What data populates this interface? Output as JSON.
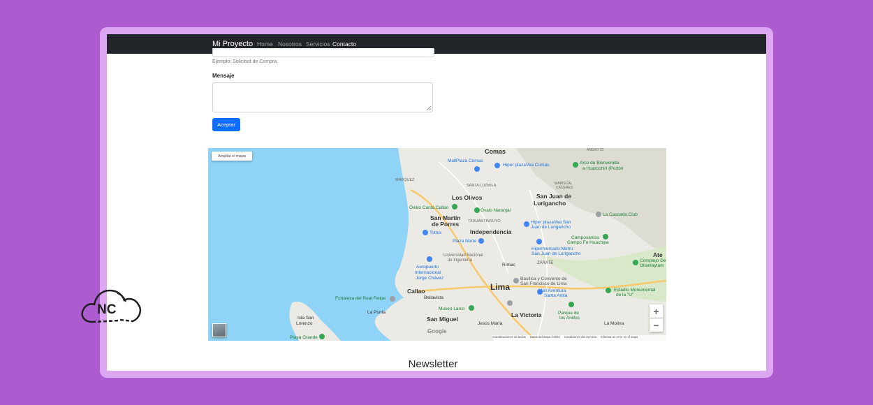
{
  "nav": {
    "brand": "Mi Proyecto",
    "links": [
      "Home",
      "Nosotros",
      "Servicios",
      "Contacto"
    ],
    "active": "Contacto"
  },
  "form": {
    "subject_help": "Ejemplo: Solicitud de Compra",
    "message_label": "Mensaje",
    "message_value": "",
    "submit_label": "Aceptar"
  },
  "map": {
    "enlarge_label": "Ampliar el mapa",
    "zoom_in": "+",
    "zoom_out": "−",
    "logo_text": "Google",
    "footer_links": [
      "Combinaciones de teclas",
      "Datos del mapa ©2022",
      "Condiciones del Servicio",
      "Informar un error en el mapa"
    ],
    "places": {
      "comas": "Comas",
      "los_olivos": "Los Olivos",
      "san_martin": "San Martín",
      "de_porres": "de Porres",
      "independencia": "Independencia",
      "lima": "Lima",
      "callao": "Callao",
      "bellavista": "Bellavista",
      "la_punta": "La Punta",
      "san_miguel": "San Miguel",
      "la_victoria": "La Victoria",
      "rimac": "Rímac",
      "zarate": "ZÁRATE",
      "sjl1": "San Juan de",
      "sjl2": "Lurigancho",
      "ate": "Ate",
      "la_molina": "La Molina",
      "isla1": "Isla San",
      "isla2": "Lorenzo",
      "playa": "Playa Grande",
      "marquez": "MARQUEZ",
      "santa_luzmila": "SANTA LUZMILA",
      "tahuantinsuyo": "TAHUANTINSUYO",
      "mariscal": "MARISCAL",
      "caceres": "CACERES",
      "jesus_maria": "Jesús María",
      "ciudad_dios": "ANEXO 22",
      "poi_mallplaza": "MallPlaza Comas",
      "poi_hiper_comas": "Hiper plazaVea Comas",
      "poi_arco1": "Arco de Bienvenida",
      "poi_arco2": "a Huarochirí (Portón",
      "poi_ovalo_callao": "Óvalo Canta Callao",
      "poi_ovalo_naranjal": "Óvalo Naranjal",
      "poi_tottus": "Tottus",
      "poi_plaza_norte": "Plaza Norte",
      "poi_uni1": "Universidad Nacional",
      "poi_uni2": "de Ingeniería",
      "poi_aero1": "Aeropuerto",
      "poi_aero2": "Internacional",
      "poi_aero3": "Jorge Chávez",
      "poi_fortaleza": "Fortaleza del Real Felipe",
      "poi_museo": "Museo Larco",
      "poi_basilica1": "Basílica y Convento de",
      "poi_basilica2": "San Francisco de Lima",
      "poi_mall_aventura1": "Mall Aventura",
      "poi_mall_aventura2": "Santa Anita",
      "poi_parque1": "Parque de",
      "poi_parque2": "los Anillos",
      "poi_estadio1": "Estadio Monumental",
      "poi_estadio2": "de la \"U\"",
      "poi_complejo1": "Complejo De",
      "poi_complejo2": "Ollantaytam",
      "poi_hiper_sjl1": "Hiper plazaVea San",
      "poi_hiper_sjl2": "Juan de Lurigancho",
      "poi_hipermercado1": "Hipermercado Metro",
      "poi_hipermercado2": "San Juan de Lurigancho",
      "poi_campo1": "Camposantos",
      "poi_campo2": "Campo Fe Huachipa",
      "poi_cascada": "La Cascada Club"
    }
  },
  "newsletter": {
    "title": "Newsletter"
  },
  "watermark": {
    "text": "NC"
  },
  "colors": {
    "background": "#ad5ccf",
    "frame": "#dca6f1",
    "navbar": "#212529",
    "primary": "#0d6efd",
    "water": "#8fd3f7"
  }
}
